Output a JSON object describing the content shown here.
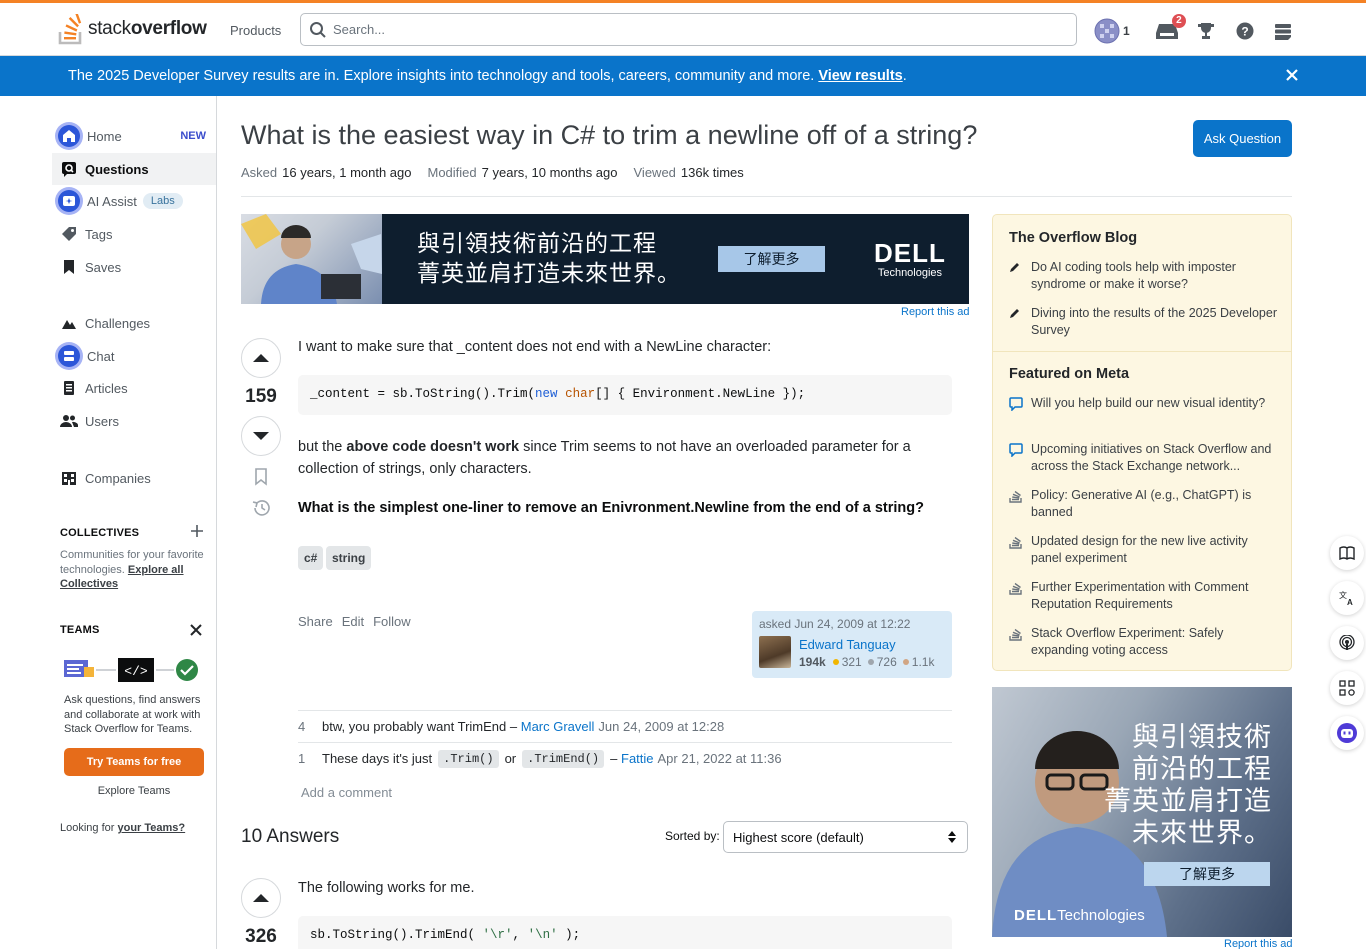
{
  "header": {
    "logo_text_light": "stack",
    "logo_text_bold": "overflow",
    "products_label": "Products",
    "search_placeholder": "Search...",
    "reputation": "1",
    "inbox_badge": "2",
    "icons": [
      "avatar-icon",
      "inbox-icon",
      "achievements-icon",
      "help-icon",
      "site-switcher-icon"
    ]
  },
  "banner": {
    "text": "The 2025 Developer Survey results are in. Explore insights into technology and tools, careers, community and more.",
    "link": "View results",
    "period": "."
  },
  "sidebar": {
    "items": [
      {
        "label": "Home",
        "icon": "home-icon",
        "tag": "NEW"
      },
      {
        "label": "Questions",
        "icon": "questions-icon",
        "active": true
      },
      {
        "label": "AI Assist",
        "icon": "ai-assist-icon",
        "tag": "Labs"
      },
      {
        "label": "Tags",
        "icon": "tag-icon"
      },
      {
        "label": "Saves",
        "icon": "bookmark-icon"
      },
      {
        "label": "Challenges",
        "icon": "challenges-icon"
      },
      {
        "label": "Chat",
        "icon": "chat-icon"
      },
      {
        "label": "Articles",
        "icon": "articles-icon"
      },
      {
        "label": "Users",
        "icon": "users-icon"
      },
      {
        "label": "Companies",
        "icon": "companies-icon"
      }
    ],
    "collectives_heading": "COLLECTIVES",
    "collectives_text": "Communities for your favorite technologies.",
    "collectives_link": "Explore all Collectives",
    "teams_heading": "TEAMS",
    "teams_text": "Ask questions, find answers and collaborate at work with Stack Overflow for Teams.",
    "teams_button": "Try Teams for free",
    "explore_teams": "Explore Teams",
    "looking_for": "Looking for",
    "your_teams": "your Teams?"
  },
  "question": {
    "title": "What is the easiest way in C# to trim a newline off of a string?",
    "ask_button": "Ask Question",
    "asked_label": "Asked",
    "asked_value": "16 years, 1 month ago",
    "modified_label": "Modified",
    "modified_value": "7 years, 10 months ago",
    "viewed_label": "Viewed",
    "viewed_value": "136k times",
    "votes": "159",
    "body_p1": "I want to make sure that _content does not end with a NewLine character:",
    "code1_a": "_content = sb.ToString().Trim(",
    "code1_kw": "new",
    "code1_ty": "char",
    "code1_b": "[] { Environment.NewLine });",
    "body_p2_a": "but the",
    "body_p2_bold": "above code doesn't work",
    "body_p2_b": "since Trim seems to not have an overloaded parameter for a collection of strings, only characters.",
    "body_p3": "What is the simplest one-liner to remove an Enivronment.Newline from the end of a string?",
    "tags": [
      "c#",
      "string"
    ],
    "actions": [
      "Share",
      "Edit",
      "Follow"
    ],
    "asked_card": "asked Jun 24, 2009 at 12:22",
    "user_name": "Edward Tanguay",
    "user_rep": "194k",
    "gold": "321",
    "silver": "726",
    "bronze": "1.1k",
    "comments": [
      {
        "score": "4",
        "text": "btw, you probably want TrimEnd –",
        "user": "Marc Gravell",
        "date": "Jun 24, 2009 at 12:28"
      },
      {
        "score": "1",
        "text_a": "These days it's just",
        "code_a": ".Trim()",
        "text_b": "or",
        "code_b": ".TrimEnd()",
        "text_c": "–",
        "user": "Fattie",
        "date": "Apr 21, 2022 at 11:36"
      }
    ],
    "add_comment": "Add a comment"
  },
  "ad": {
    "line1": "與引領技術前沿的工程",
    "line2": "菁英並肩打造未來世界。",
    "button": "了解更多",
    "brand": "DELL",
    "brand_sub": "Technologies",
    "report": "Report this ad"
  },
  "answers": {
    "heading": "10 Answers",
    "sorted_label": "Sorted by:",
    "sort_value": "Highest score (default)",
    "first_votes": "326",
    "first_text": "The following works for me.",
    "first_code_a": "sb.ToString().TrimEnd( ",
    "first_code_s1": "'\\r'",
    "first_code_sep": ", ",
    "first_code_s2": "'\\n'",
    "first_code_b": " );"
  },
  "right": {
    "blog_heading": "The Overflow Blog",
    "blog_items": [
      "Do AI coding tools help with imposter syndrome or make it worse?",
      "Diving into the results of the 2025 Developer Survey"
    ],
    "meta_heading": "Featured on Meta",
    "meta_items": [
      {
        "text": "Will you help build our new visual identity?",
        "icon": "comment-icon"
      },
      {
        "text": "Upcoming initiatives on Stack Overflow and across the Stack Exchange network...",
        "icon": "comment-icon"
      },
      {
        "text": "Policy: Generative AI (e.g., ChatGPT) is banned",
        "icon": "stack-icon"
      },
      {
        "text": "Updated design for the new live activity panel experiment",
        "icon": "stack-icon"
      },
      {
        "text": "Further Experimentation with Comment Reputation Requirements",
        "icon": "stack-icon"
      },
      {
        "text": "Stack Overflow Experiment: Safely expanding voting access",
        "icon": "stack-icon"
      }
    ],
    "ad2_line1": "與引領技術",
    "ad2_line2": "前沿的工程",
    "ad2_line3": "菁英並肩打造",
    "ad2_line4": "未來世界。",
    "ad2_button": "了解更多",
    "ad2_brand": "DELL",
    "ad2_brand_sub": "Technologies",
    "ad2_report": "Report this ad"
  },
  "float_tools": [
    "reader-icon",
    "translate-icon",
    "podcast-icon",
    "apps-icon",
    "assistant-icon"
  ],
  "colors": {
    "accent": "#0a74ca",
    "orange": "#f48225",
    "banner": "#0a74ca",
    "blog_bg": "#fdf7e2"
  }
}
